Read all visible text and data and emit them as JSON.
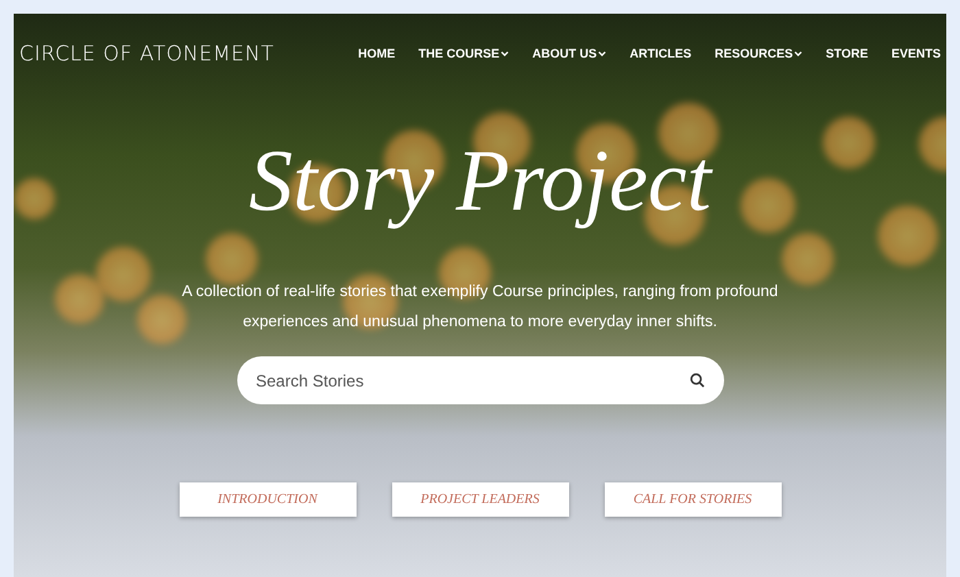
{
  "site": {
    "logo": "CIRCLE OF ATONEMENT"
  },
  "nav": [
    {
      "label": "HOME",
      "dropdown": false
    },
    {
      "label": "THE COURSE",
      "dropdown": true
    },
    {
      "label": "ABOUT US",
      "dropdown": true
    },
    {
      "label": "ARTICLES",
      "dropdown": false
    },
    {
      "label": "RESOURCES",
      "dropdown": true
    },
    {
      "label": "STORE",
      "dropdown": false
    },
    {
      "label": "EVENTS",
      "dropdown": false
    }
  ],
  "hero": {
    "title": "Story Project",
    "description": "A collection of real-life stories that exemplify Course principles, ranging from profound experiences and unusual phenomena to more everyday inner shifts."
  },
  "search": {
    "placeholder": "Search Stories"
  },
  "buttons": [
    "INTRODUCTION",
    "PROJECT LEADERS",
    "CALL FOR STORIES"
  ]
}
